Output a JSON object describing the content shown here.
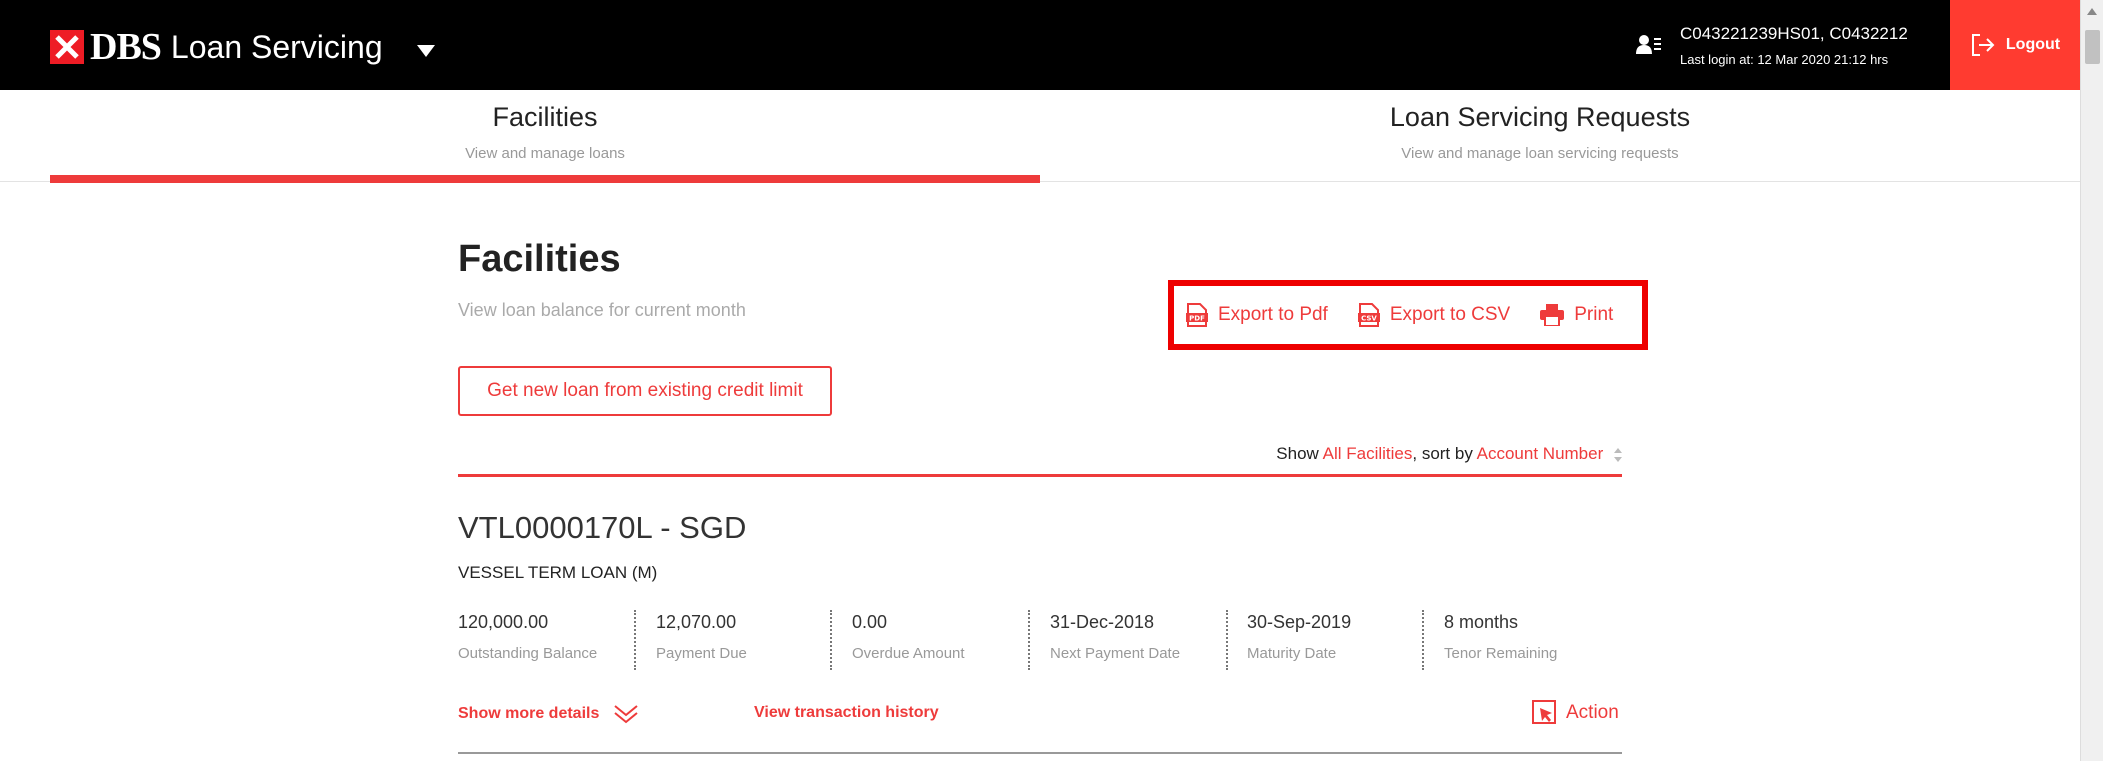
{
  "header": {
    "brand_name": "DBS",
    "app_name": "Loan Servicing",
    "user_id": "C043221239HS01, C0432212",
    "last_login": "Last login at: 12 Mar 2020 21:12 hrs",
    "logout_label": "Logout"
  },
  "tabs": [
    {
      "title": "Facilities",
      "subtitle": "View and manage loans",
      "active": true
    },
    {
      "title": "Loan Servicing Requests",
      "subtitle": "View and manage loan servicing requests",
      "active": false
    }
  ],
  "page": {
    "title": "Facilities",
    "subtitle": "View loan balance for current month",
    "new_loan_label": "Get new loan from existing credit limit"
  },
  "exports": {
    "pdf_label": "Export to Pdf",
    "csv_label": "Export to CSV",
    "print_label": "Print"
  },
  "sort": {
    "show_label": "Show",
    "filter_value": "All Facilities",
    "sort_label": ", sort by",
    "sort_value": "Account Number"
  },
  "facility": {
    "account": "VTL0000170L - SGD",
    "type": "VESSEL TERM LOAN (M)",
    "stats": [
      {
        "value": "120,000.00",
        "label": "Outstanding Balance"
      },
      {
        "value": "12,070.00",
        "label": "Payment Due"
      },
      {
        "value": "0.00",
        "label": "Overdue Amount"
      },
      {
        "value": "31-Dec-2018",
        "label": "Next Payment Date"
      },
      {
        "value": "30-Sep-2019",
        "label": "Maturity Date"
      },
      {
        "value": "8 months",
        "label": "Tenor Remaining"
      }
    ],
    "show_more_label": "Show more details",
    "history_label": "View transaction history",
    "action_label": "Action"
  },
  "colors": {
    "accent": "#ee3b3b",
    "logout_bg": "#ff3b30",
    "topbar_bg": "#000000",
    "highlight_box": "#ee0000"
  }
}
